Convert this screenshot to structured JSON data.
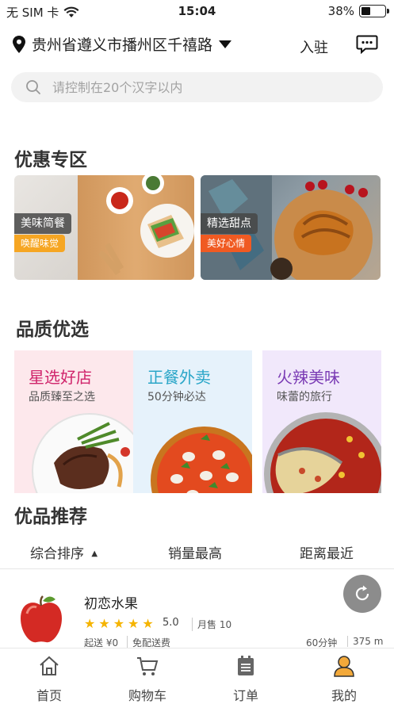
{
  "status_bar": {
    "carrier": "无 SIM 卡",
    "time": "15:04",
    "battery": "38%",
    "battery_level": 0.38
  },
  "header": {
    "location": "贵州省遵义市播州区千禧路",
    "join_label": "入驻"
  },
  "search": {
    "placeholder": "请控制在20个汉字以内"
  },
  "discount": {
    "title": "优惠专区",
    "cards": [
      {
        "tag": "美味简餐",
        "sub": "唤醒味觉",
        "sub_color": "#f6a623"
      },
      {
        "tag": "精选甜点",
        "sub": "美好心情",
        "sub_color": "#f05a22"
      }
    ]
  },
  "quality": {
    "title": "品质优选",
    "cards": [
      {
        "title": "星选好店",
        "sub": "品质臻至之选",
        "title_color": "#d0246b",
        "bg": "#fde8ec"
      },
      {
        "title": "正餐外卖",
        "sub": "50分钟必达",
        "title_color": "#2aa6c8",
        "bg": "#e6f2fb"
      },
      {
        "title": "火辣美味",
        "sub": "味蕾的旅行",
        "title_color": "#7a3bb4",
        "bg": "#f1e8fb"
      }
    ]
  },
  "recommend": {
    "title": "优品推荐",
    "sort_tabs": [
      "综合排序",
      "销量最高",
      "距离最近"
    ],
    "sort_arrow": "▲",
    "items": [
      {
        "name": "初恋水果",
        "rating": "5.0",
        "stars": 5,
        "sold": "月售 10",
        "min_order": "起送 ¥0",
        "delivery": "免配送费",
        "eta": "60分钟",
        "distance": "375 m"
      }
    ]
  },
  "tabbar": {
    "tabs": [
      {
        "label": "首页",
        "icon": "home-icon"
      },
      {
        "label": "购物车",
        "icon": "cart-icon"
      },
      {
        "label": "订单",
        "icon": "order-icon"
      },
      {
        "label": "我的",
        "icon": "user-icon"
      }
    ]
  }
}
